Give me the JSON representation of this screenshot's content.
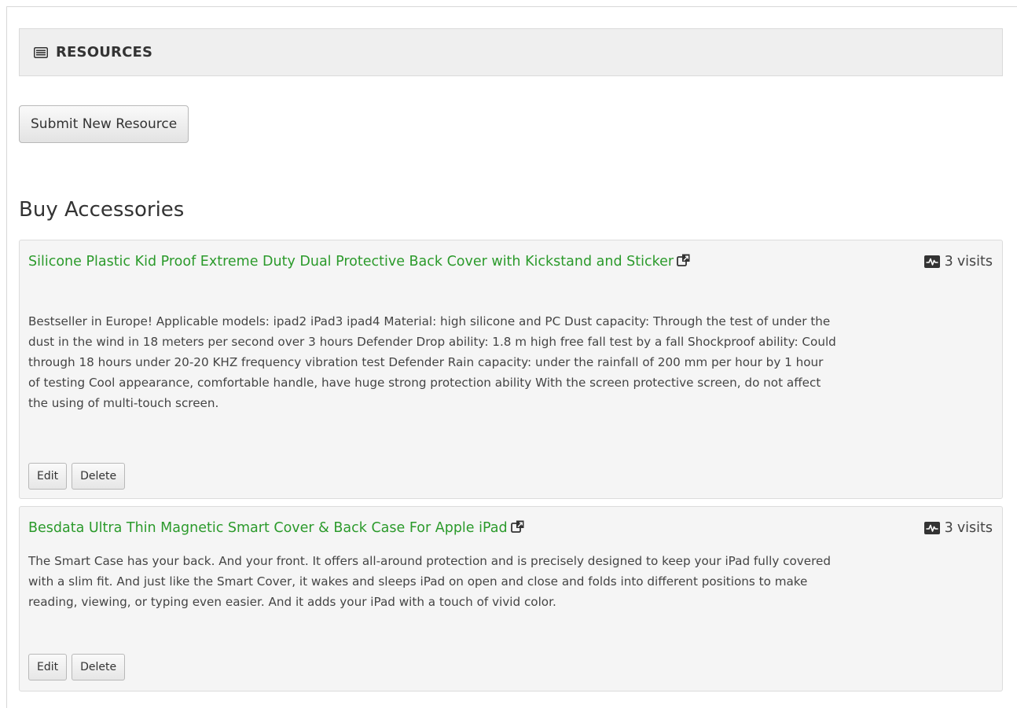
{
  "section": {
    "title": "RESOURCES",
    "icon": "list-icon"
  },
  "actions": {
    "submit_label": "Submit New Resource"
  },
  "category": {
    "title": "Buy Accessories"
  },
  "resources": [
    {
      "title": "Silicone Plastic Kid Proof Extreme Duty Dual Protective Back Cover with Kickstand and Sticker",
      "description": "Bestseller in Europe! Applicable models: ipad2 iPad3 ipad4 Material: high silicone and PC Dust capacity: Through the test of under the dust in the wind in 18 meters per second over 3 hours Defender Drop ability: 1.8 m high free fall test by a fall Shockproof ability: Could through 18 hours under 20-20 KHZ frequency vibration test Defender Rain capacity: under the rainfall of 200 mm per hour by 1 hour of testing Cool appearance, comfortable handle, have huge strong protection ability With the screen protective screen, do not affect the using of multi-touch screen.",
      "visits_count": "3",
      "visits_label": "visits",
      "edit_label": "Edit",
      "delete_label": "Delete"
    },
    {
      "title": "Besdata Ultra Thin Magnetic Smart Cover & Back Case For Apple iPad",
      "description": "The Smart Case has your back. And your front. It offers all-around protection and is precisely designed to keep your iPad fully covered with a slim fit. And just like the Smart Cover, it wakes and sleeps iPad on open and close and folds into different positions to make reading, viewing, or typing even easier. And it adds your iPad with a touch of vivid color.",
      "visits_count": "3",
      "visits_label": "visits",
      "edit_label": "Edit",
      "delete_label": "Delete"
    }
  ],
  "colors": {
    "link": "#2b9a2b",
    "header_bg": "#efefef",
    "card_bg": "#f5f5f5"
  }
}
